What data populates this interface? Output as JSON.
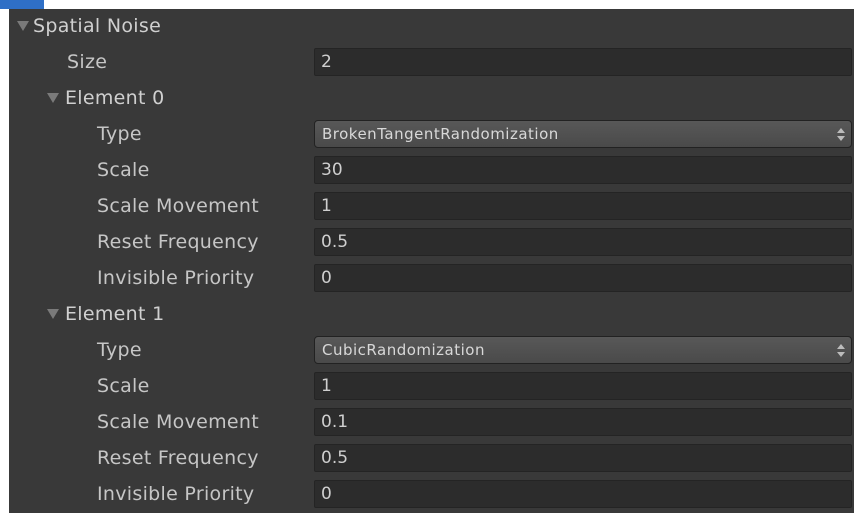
{
  "spatial_noise": {
    "label": "Spatial Noise",
    "size_label": "Size",
    "size_value": "2",
    "elements": [
      {
        "label": "Element 0",
        "type_label": "Type",
        "type_value": "BrokenTangentRandomization",
        "scale_label": "Scale",
        "scale_value": "30",
        "scale_movement_label": "Scale Movement",
        "scale_movement_value": "1",
        "reset_frequency_label": "Reset Frequency",
        "reset_frequency_value": "0.5",
        "invisible_priority_label": "Invisible Priority",
        "invisible_priority_value": "0"
      },
      {
        "label": "Element 1",
        "type_label": "Type",
        "type_value": "CubicRandomization",
        "scale_label": "Scale",
        "scale_value": "1",
        "scale_movement_label": "Scale Movement",
        "scale_movement_value": "0.1",
        "reset_frequency_label": "Reset Frequency",
        "reset_frequency_value": "0.5",
        "invisible_priority_label": "Invisible Priority",
        "invisible_priority_value": "0"
      }
    ]
  },
  "icons": {
    "foldout": "triangle-down-icon",
    "dropdown": "up-down-arrows-icon"
  },
  "colors": {
    "panel_background": "#393939",
    "field_background": "#2c2c2c",
    "text": "#c6c6c6",
    "accent": "#2f6fc6"
  }
}
